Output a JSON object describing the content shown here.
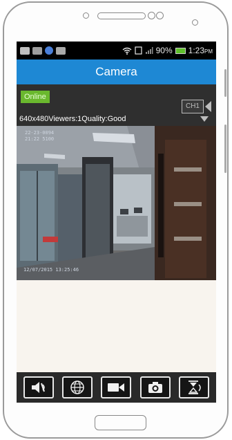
{
  "status_bar": {
    "battery_percent": "90%",
    "time": "1:23",
    "time_suffix": "PM"
  },
  "header": {
    "title": "Camera"
  },
  "stream": {
    "status_badge": "Online",
    "stats": "640x480Viewers:1Quality:Good",
    "channel": "CH1"
  },
  "video_overlay": {
    "top_line1": "22-23-0094",
    "top_line2": "21:22 5100",
    "bottom": "12/07/2015  13:25:46"
  },
  "toolbar": {
    "buttons": [
      {
        "name": "mute-button",
        "icon": "speaker-mute-icon"
      },
      {
        "name": "globe-button",
        "icon": "globe-icon"
      },
      {
        "name": "record-button",
        "icon": "video-camera-icon"
      },
      {
        "name": "snapshot-button",
        "icon": "camera-icon"
      },
      {
        "name": "flip-button",
        "icon": "flip-icon"
      }
    ]
  },
  "colors": {
    "title_bar": "#1e88d4",
    "online_badge": "#6ab82e",
    "info_panel": "#2f2f2f",
    "toolbar": "#2a2a2a"
  }
}
